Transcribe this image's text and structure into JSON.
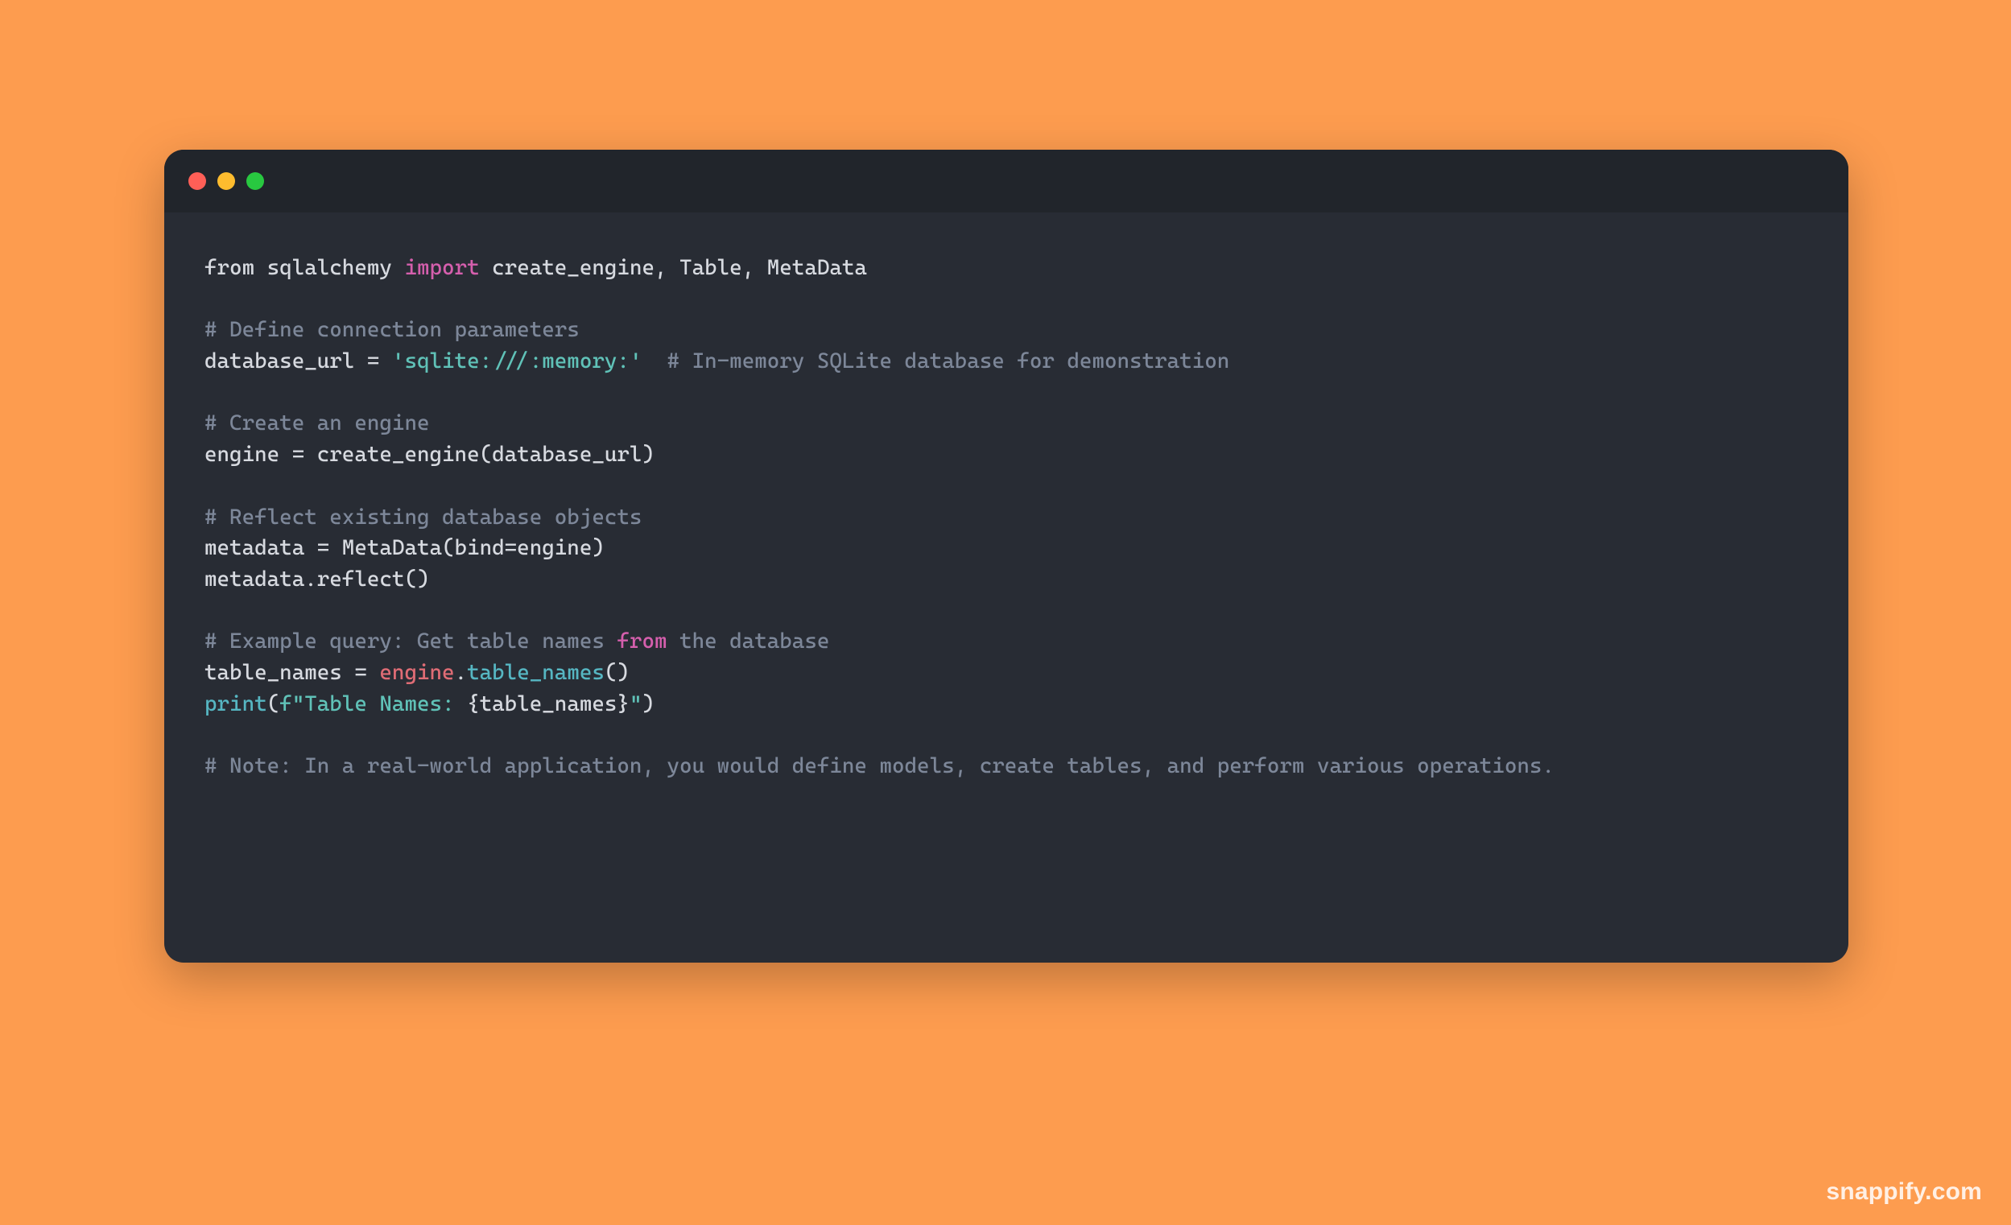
{
  "watermark": "snappify.com",
  "code": {
    "l1_a": "from",
    "l1_b": " sqlalchemy ",
    "l1_c": "import",
    "l1_d": " create_engine, Table, MetaData",
    "l3": "# Define connection parameters",
    "l4_a": "database_url = ",
    "l4_b": "'sqlite:///:memory:'",
    "l4_c": "  ",
    "l4_d": "# In-memory SQLite database for demonstration",
    "l6": "# Create an engine",
    "l7": "engine = create_engine(database_url)",
    "l9": "# Reflect existing database objects",
    "l10": "metadata = MetaData(bind=engine)",
    "l11": "metadata.reflect()",
    "l13_a": "# Example query: Get table names ",
    "l13_b": "from",
    "l13_c": " the database",
    "l14_a": "table_names = ",
    "l14_b": "engine",
    "l14_c": ".",
    "l14_d": "table_names",
    "l14_e": "()",
    "l15_a": "print",
    "l15_b": "(",
    "l15_c": "f\"Table Names: ",
    "l15_d": "{table_names}",
    "l15_e": "\"",
    "l15_f": ")",
    "l17": "# Note: In a real-world application, you would define models, create tables, and perform various operations."
  }
}
